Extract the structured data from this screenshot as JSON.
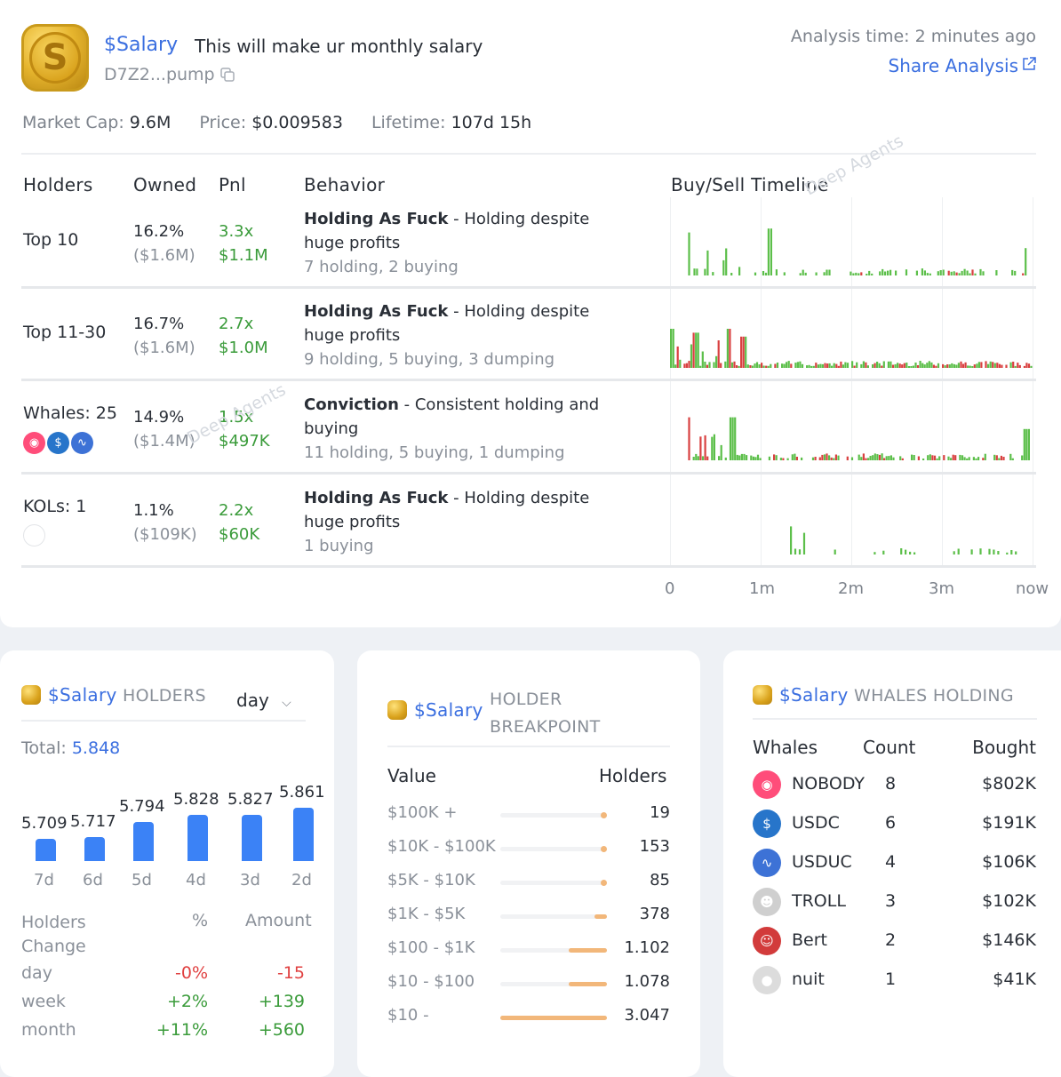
{
  "token": {
    "symbol": "$Salary",
    "description": "This will make ur monthly salary",
    "address": "D7Z2...pump",
    "logo_letter": "S"
  },
  "header": {
    "analysis_time": "Analysis time: 2 minutes ago",
    "share_label": "Share Analysis"
  },
  "stats": {
    "market_cap_label": "Market Cap:",
    "market_cap": "9.6M",
    "price_label": "Price:",
    "price": "$0.009583",
    "lifetime_label": "Lifetime:",
    "lifetime": "107d 15h"
  },
  "table": {
    "headers": {
      "holders": "Holders",
      "owned": "Owned",
      "pnl": "Pnl",
      "behavior": "Behavior",
      "timeline": "Buy/Sell Timeline"
    },
    "rows": [
      {
        "label": "Top 10",
        "owned_pct": "16.2%",
        "owned_usd": "($1.6M)",
        "pnl_x": "3.3x",
        "pnl_usd": "$1.1M",
        "behavior_title": "Holding As Fuck",
        "behavior_desc_1": " - Holding despite",
        "behavior_desc_2": "huge profits",
        "behavior_counts": "7 holding, 2 buying"
      },
      {
        "label": "Top 11-30",
        "owned_pct": "16.7%",
        "owned_usd": "($1.6M)",
        "pnl_x": "2.7x",
        "pnl_usd": "$1.0M",
        "behavior_title": "Holding As Fuck",
        "behavior_desc_1": " - Holding despite",
        "behavior_desc_2": "huge profits",
        "behavior_counts": "9 holding, 5 buying, 3 dumping"
      },
      {
        "label": "Whales: 25",
        "owned_pct": "14.9%",
        "owned_usd": "($1.4M)",
        "pnl_x": "1.5x",
        "pnl_usd": "$497K",
        "behavior_title": "Conviction",
        "behavior_desc_1": " - Consistent holding and",
        "behavior_desc_2": "buying",
        "behavior_counts": "11 holding, 5 buying, 1 dumping"
      },
      {
        "label": "KOLs: 1",
        "owned_pct": "1.1%",
        "owned_usd": "($109K)",
        "pnl_x": "2.2x",
        "pnl_usd": "$60K",
        "behavior_title": "Holding As Fuck",
        "behavior_desc_1": " - Holding despite",
        "behavior_desc_2": "huge profits",
        "behavior_counts": "1 buying"
      }
    ],
    "timeline_axis": [
      "0",
      "1m",
      "2m",
      "3m",
      "now"
    ]
  },
  "watermark": "Deep Agents",
  "holders_card": {
    "symbol": "$Salary",
    "title": "HOLDERS",
    "period": "day",
    "total_label": "Total:",
    "total_value": "5.848",
    "bars": [
      {
        "label": "7d",
        "value": 5.709,
        "text": "5.709"
      },
      {
        "label": "6d",
        "value": 5.717,
        "text": "5.717"
      },
      {
        "label": "5d",
        "value": 5.794,
        "text": "5.794"
      },
      {
        "label": "4d",
        "value": 5.828,
        "text": "5.828"
      },
      {
        "label": "3d",
        "value": 5.827,
        "text": "5.827"
      },
      {
        "label": "2d",
        "value": 5.861,
        "text": "5.861"
      }
    ],
    "change_headers": {
      "label": "Holders Change",
      "pct": "%",
      "amount": "Amount"
    },
    "changes": [
      {
        "period": "day",
        "pct": "-0%",
        "amount": "-15",
        "color": "#e04040"
      },
      {
        "period": "week",
        "pct": "+2%",
        "amount": "+139",
        "color": "#3a9b3a"
      },
      {
        "period": "month",
        "pct": "+11%",
        "amount": "+560",
        "color": "#3a9b3a"
      }
    ]
  },
  "breakpoint_card": {
    "symbol": "$Salary",
    "title_1": "HOLDER",
    "title_2": "BREAKPOINT",
    "headers": {
      "value": "Value",
      "holders": "Holders"
    },
    "rows": [
      {
        "range": "$100K +",
        "holders": "19",
        "share": 0.005
      },
      {
        "range": "$10K - $100K",
        "holders": "153",
        "share": 0.04
      },
      {
        "range": "$5K - $10K",
        "holders": "85",
        "share": 0.02
      },
      {
        "range": "$1K - $5K",
        "holders": "378",
        "share": 0.12
      },
      {
        "range": "$100 - $1K",
        "holders": "1.102",
        "share": 0.36
      },
      {
        "range": "$10 - $100",
        "holders": "1.078",
        "share": 0.36
      },
      {
        "range": "$10 -",
        "holders": "3.047",
        "share": 1.0
      }
    ]
  },
  "whales_card": {
    "symbol": "$Salary",
    "title": "WHALES HOLDING",
    "headers": {
      "whales": "Whales",
      "count": "Count",
      "bought": "Bought"
    },
    "rows": [
      {
        "name": "NOBODY",
        "count": "8",
        "bought": "$802K",
        "icon": "nobody-icon",
        "color": "#ff4d7a"
      },
      {
        "name": "USDC",
        "count": "6",
        "bought": "$191K",
        "icon": "usdc-icon",
        "color": "#2775ca"
      },
      {
        "name": "USDUC",
        "count": "4",
        "bought": "$106K",
        "icon": "usduc-icon",
        "color": "#3d72d6"
      },
      {
        "name": "TROLL",
        "count": "3",
        "bought": "$102K",
        "icon": "troll-icon",
        "color": "#cfcfcf"
      },
      {
        "name": "Bert",
        "count": "2",
        "bought": "$146K",
        "icon": "bert-icon",
        "color": "#d23b3b"
      },
      {
        "name": "nuit",
        "count": "1",
        "bought": "$41K",
        "icon": "nuit-icon",
        "color": "#dcdcdc"
      }
    ]
  },
  "colors": {
    "accent": "#3b6fe0",
    "buy": "#5cbf4a",
    "sell": "#d94040",
    "bar": "#3b82f6",
    "breakpoint": "#f2b77a"
  }
}
